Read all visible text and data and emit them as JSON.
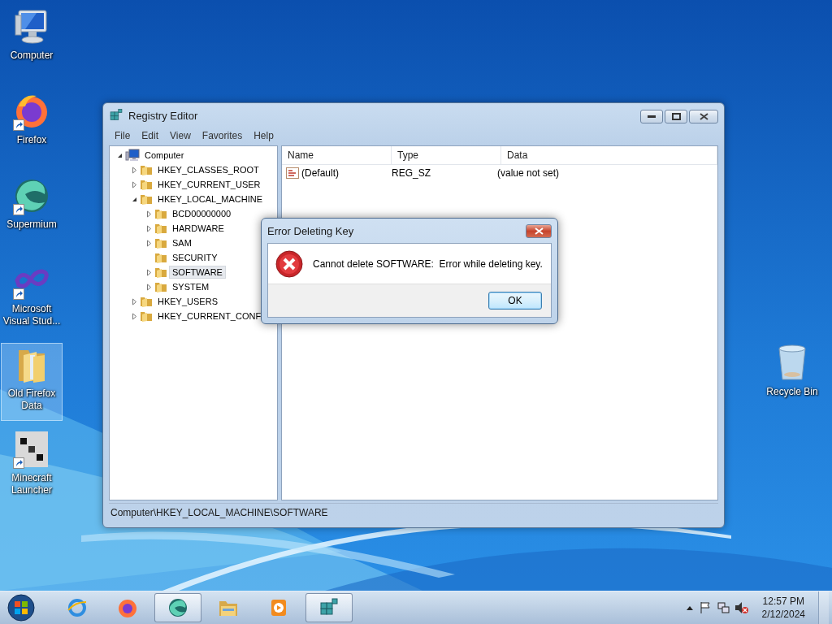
{
  "desktop_icons": [
    {
      "label": "Computer",
      "kind": "computer",
      "shortcut": false,
      "selected": false
    },
    {
      "label": "Firefox",
      "kind": "firefox",
      "shortcut": true,
      "selected": false
    },
    {
      "label": "Supermium",
      "kind": "supermium",
      "shortcut": true,
      "selected": false
    },
    {
      "label": "Microsoft Visual Stud...",
      "kind": "studio",
      "shortcut": true,
      "selected": false
    },
    {
      "label": "Old Firefox Data",
      "kind": "folder",
      "shortcut": false,
      "selected": true
    },
    {
      "label": "Minecraft Launcher",
      "kind": "block",
      "shortcut": true,
      "selected": false
    }
  ],
  "recycle_bin": {
    "label": "Recycle Bin"
  },
  "registry_editor": {
    "title": "Registry Editor",
    "menu": [
      "File",
      "Edit",
      "View",
      "Favorites",
      "Help"
    ],
    "tree": {
      "label": "Computer",
      "kind": "computer",
      "expandable": true,
      "expanded": true,
      "selected": false,
      "children": [
        {
          "label": "HKEY_CLASSES_ROOT",
          "kind": "folder",
          "expandable": true,
          "expanded": false,
          "selected": false
        },
        {
          "label": "HKEY_CURRENT_USER",
          "kind": "folder",
          "expandable": true,
          "expanded": false,
          "selected": false
        },
        {
          "label": "HKEY_LOCAL_MACHINE",
          "kind": "folder",
          "expandable": true,
          "expanded": true,
          "selected": false,
          "children": [
            {
              "label": "BCD00000000",
              "kind": "folder",
              "expandable": true,
              "expanded": false,
              "selected": false
            },
            {
              "label": "HARDWARE",
              "kind": "folder",
              "expandable": true,
              "expanded": false,
              "selected": false
            },
            {
              "label": "SAM",
              "kind": "folder",
              "expandable": true,
              "expanded": false,
              "selected": false
            },
            {
              "label": "SECURITY",
              "kind": "folder",
              "expandable": false,
              "expanded": false,
              "selected": false
            },
            {
              "label": "SOFTWARE",
              "kind": "folder",
              "expandable": true,
              "expanded": false,
              "selected": true
            },
            {
              "label": "SYSTEM",
              "kind": "folder",
              "expandable": true,
              "expanded": false,
              "selected": false
            }
          ]
        },
        {
          "label": "HKEY_USERS",
          "kind": "folder",
          "expandable": true,
          "expanded": false,
          "selected": false
        },
        {
          "label": "HKEY_CURRENT_CONF",
          "kind": "folder",
          "expandable": true,
          "expanded": false,
          "selected": false
        }
      ]
    },
    "columns": [
      "Name",
      "Type",
      "Data"
    ],
    "rows": [
      {
        "name": "(Default)",
        "type": "REG_SZ",
        "data": "(value not set)"
      }
    ],
    "status_bar": "Computer\\HKEY_LOCAL_MACHINE\\SOFTWARE"
  },
  "dialog": {
    "title": "Error Deleting Key",
    "message": "Cannot delete SOFTWARE:  Error while deleting key.",
    "buttons": [
      "OK"
    ]
  },
  "taskbar": {
    "apps": [
      {
        "kind": "browser",
        "open": false
      },
      {
        "kind": "firefox",
        "open": false
      },
      {
        "kind": "supermium",
        "open": true
      },
      {
        "kind": "explorer",
        "open": false
      },
      {
        "kind": "player",
        "open": false
      },
      {
        "kind": "regedit",
        "open": true
      }
    ],
    "clock": {
      "time": "12:57 PM",
      "date": "2/12/2024"
    }
  }
}
